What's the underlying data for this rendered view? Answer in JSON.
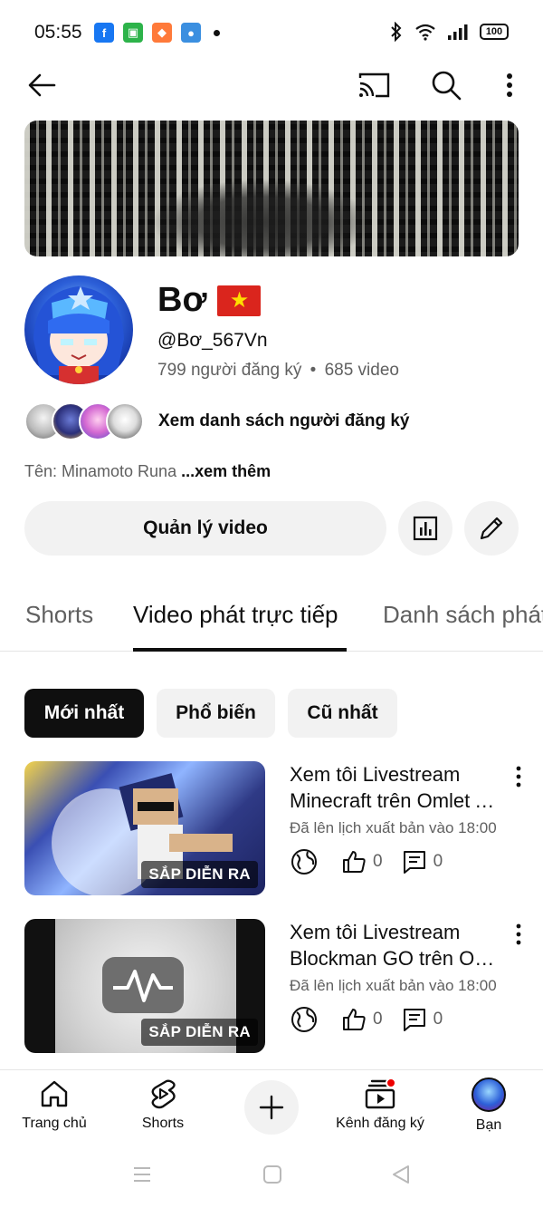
{
  "status_bar": {
    "time": "05:55",
    "battery": "100",
    "apps": [
      {
        "name": "facebook-icon",
        "glyph": "f",
        "color": "#1877f2"
      },
      {
        "name": "app-green-icon",
        "glyph": "▣",
        "color": "#2db34a"
      },
      {
        "name": "game-app-icon",
        "glyph": "◆",
        "color": "#ff7a3a"
      },
      {
        "name": "blue-app-icon",
        "glyph": "●",
        "color": "#3b8fe0"
      }
    ]
  },
  "channel": {
    "name": "Bơ",
    "handle": "@Bơ_567Vn",
    "subscribers": "799 người đăng ký",
    "separator": "•",
    "video_count": "685 video",
    "subscriber_list_label": "Xem danh sách người đăng ký",
    "description": "Tên: Minamoto Runa ",
    "description_more": "...xem thêm",
    "manage_button": "Quản lý video",
    "flag_star": "★"
  },
  "tabs": [
    {
      "label": "Shorts",
      "active": false
    },
    {
      "label": "Video phát trực tiếp",
      "active": true
    },
    {
      "label": "Danh sách phát",
      "active": false
    }
  ],
  "filters": [
    {
      "label": "Mới nhất",
      "active": true
    },
    {
      "label": "Phổ biến",
      "active": false
    },
    {
      "label": "Cũ nhất",
      "active": false
    }
  ],
  "videos": [
    {
      "title_line1": "Xem tôi Livestream",
      "title_line2": "Minecraft trên Omlet Arcade!",
      "schedule": "Đã lên lịch xuất bản vào 18:00",
      "likes": "0",
      "comments": "0",
      "badge": "SẮP DIỄN RA"
    },
    {
      "title_line1": "Xem tôi Livestream",
      "title_line2": "Blockman GO trên Omlet Arcade!",
      "schedule": "Đã lên lịch xuất bản vào 18:00",
      "likes": "0",
      "comments": "0",
      "badge": "SẮP DIỄN RA"
    }
  ],
  "bottom_nav": [
    {
      "label": "Trang chủ",
      "icon": "home-icon"
    },
    {
      "label": "Shorts",
      "icon": "shorts-icon"
    },
    {
      "label": "",
      "icon": "create-icon"
    },
    {
      "label": "Kênh đăng ký",
      "icon": "subscriptions-icon"
    },
    {
      "label": "Bạn",
      "icon": "you-avatar"
    }
  ],
  "colors": {
    "accent_red": "#ff0000",
    "text_primary": "#0f0f0f",
    "text_secondary": "#606060",
    "chip_bg": "#f2f2f2"
  }
}
